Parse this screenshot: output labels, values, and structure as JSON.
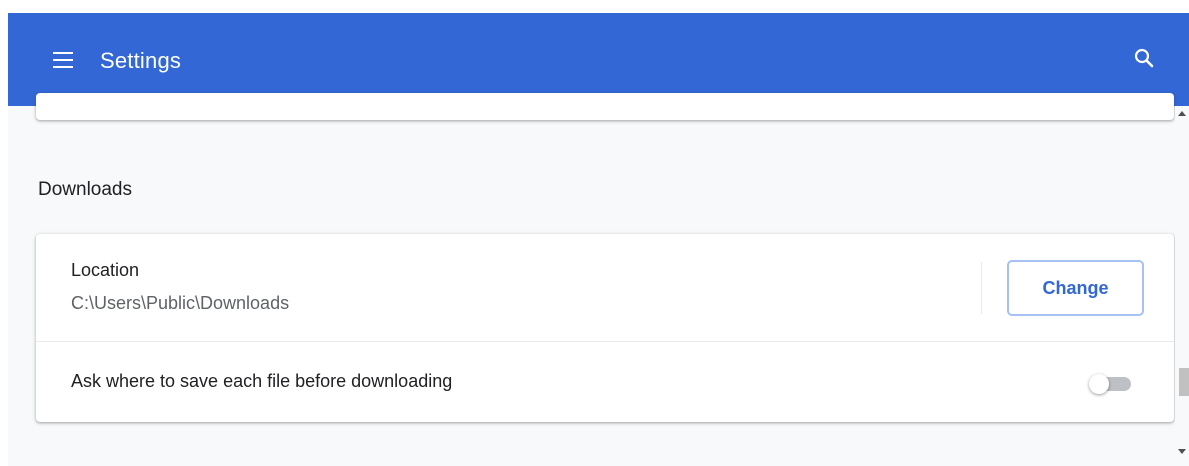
{
  "header": {
    "title": "Settings",
    "menu_icon": "hamburger-menu-icon",
    "search_icon": "search-icon",
    "background_color": "#3367d6"
  },
  "downloads": {
    "section_title": "Downloads",
    "location": {
      "label": "Location",
      "path": "C:\\Users\\Public\\Downloads",
      "change_button_label": "Change"
    },
    "ask_where_to_save": {
      "label": "Ask where to save each file before downloading",
      "enabled": false
    }
  },
  "colors": {
    "accent": "#3367d6",
    "page_background": "#f8f9fa",
    "card_background": "#ffffff",
    "primary_text": "#202124",
    "secondary_text": "#5f6368"
  }
}
